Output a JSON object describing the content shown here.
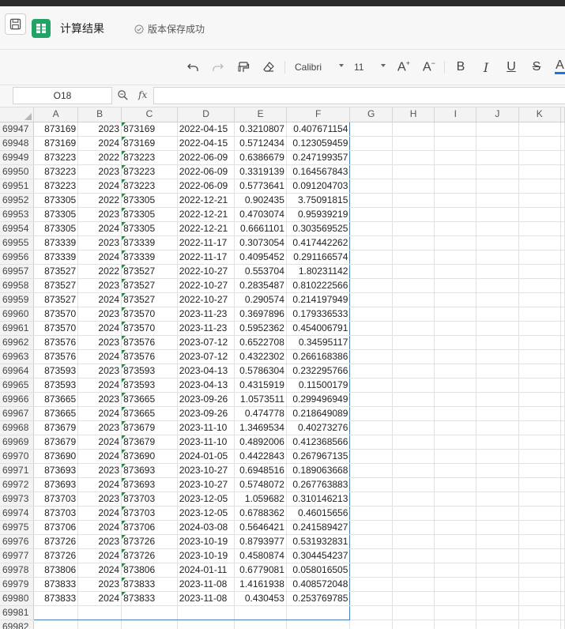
{
  "titlebar": {
    "doc_title": "计算结果",
    "save_status": "版本保存成功"
  },
  "toolbar": {
    "font_name": "Calibri",
    "font_size": "11",
    "bold": "B",
    "italic": "I",
    "underline": "U",
    "strike": "S",
    "font_color": "A"
  },
  "formula_bar": {
    "cell_ref": "O18",
    "fx": "fx",
    "value": ""
  },
  "colors": {
    "accent": "#21a366",
    "selection": "#4a7ebb",
    "text_flag": "#1e8e3e",
    "font_color_bar": "#1a73e8"
  },
  "sheet": {
    "columns": [
      "A",
      "B",
      "C",
      "D",
      "E",
      "F",
      "G",
      "H",
      "I",
      "J",
      "K"
    ],
    "rows": [
      {
        "n": "69947",
        "a": "873169",
        "b": "2023",
        "c": "873169",
        "d": "2022-04-15",
        "e": "0.3210807",
        "f": "0.407671154"
      },
      {
        "n": "69948",
        "a": "873169",
        "b": "2024",
        "c": "873169",
        "d": "2022-04-15",
        "e": "0.5712434",
        "f": "0.123059459"
      },
      {
        "n": "69949",
        "a": "873223",
        "b": "2022",
        "c": "873223",
        "d": "2022-06-09",
        "e": "0.6386679",
        "f": "0.247199357"
      },
      {
        "n": "69950",
        "a": "873223",
        "b": "2023",
        "c": "873223",
        "d": "2022-06-09",
        "e": "0.3319139",
        "f": "0.164567843"
      },
      {
        "n": "69951",
        "a": "873223",
        "b": "2024",
        "c": "873223",
        "d": "2022-06-09",
        "e": "0.5773641",
        "f": "0.091204703"
      },
      {
        "n": "69952",
        "a": "873305",
        "b": "2022",
        "c": "873305",
        "d": "2022-12-21",
        "e": "0.902435",
        "f": "3.75091815"
      },
      {
        "n": "69953",
        "a": "873305",
        "b": "2023",
        "c": "873305",
        "d": "2022-12-21",
        "e": "0.4703074",
        "f": "0.95939219"
      },
      {
        "n": "69954",
        "a": "873305",
        "b": "2024",
        "c": "873305",
        "d": "2022-12-21",
        "e": "0.6661101",
        "f": "0.303569525"
      },
      {
        "n": "69955",
        "a": "873339",
        "b": "2023",
        "c": "873339",
        "d": "2022-11-17",
        "e": "0.3073054",
        "f": "0.417442262"
      },
      {
        "n": "69956",
        "a": "873339",
        "b": "2024",
        "c": "873339",
        "d": "2022-11-17",
        "e": "0.4095452",
        "f": "0.291166574"
      },
      {
        "n": "69957",
        "a": "873527",
        "b": "2022",
        "c": "873527",
        "d": "2022-10-27",
        "e": "0.553704",
        "f": "1.80231142"
      },
      {
        "n": "69958",
        "a": "873527",
        "b": "2023",
        "c": "873527",
        "d": "2022-10-27",
        "e": "0.2835487",
        "f": "0.810222566"
      },
      {
        "n": "69959",
        "a": "873527",
        "b": "2024",
        "c": "873527",
        "d": "2022-10-27",
        "e": "0.290574",
        "f": "0.214197949"
      },
      {
        "n": "69960",
        "a": "873570",
        "b": "2023",
        "c": "873570",
        "d": "2023-11-23",
        "e": "0.3697896",
        "f": "0.179336533"
      },
      {
        "n": "69961",
        "a": "873570",
        "b": "2024",
        "c": "873570",
        "d": "2023-11-23",
        "e": "0.5952362",
        "f": "0.454006791"
      },
      {
        "n": "69962",
        "a": "873576",
        "b": "2023",
        "c": "873576",
        "d": "2023-07-12",
        "e": "0.6522708",
        "f": "0.34595117"
      },
      {
        "n": "69963",
        "a": "873576",
        "b": "2024",
        "c": "873576",
        "d": "2023-07-12",
        "e": "0.4322302",
        "f": "0.266168386"
      },
      {
        "n": "69964",
        "a": "873593",
        "b": "2023",
        "c": "873593",
        "d": "2023-04-13",
        "e": "0.5786304",
        "f": "0.232295766"
      },
      {
        "n": "69965",
        "a": "873593",
        "b": "2024",
        "c": "873593",
        "d": "2023-04-13",
        "e": "0.4315919",
        "f": "0.11500179"
      },
      {
        "n": "69966",
        "a": "873665",
        "b": "2023",
        "c": "873665",
        "d": "2023-09-26",
        "e": "1.0573511",
        "f": "0.299496949"
      },
      {
        "n": "69967",
        "a": "873665",
        "b": "2024",
        "c": "873665",
        "d": "2023-09-26",
        "e": "0.474778",
        "f": "0.218649089"
      },
      {
        "n": "69968",
        "a": "873679",
        "b": "2023",
        "c": "873679",
        "d": "2023-11-10",
        "e": "1.3469534",
        "f": "0.40273276"
      },
      {
        "n": "69969",
        "a": "873679",
        "b": "2024",
        "c": "873679",
        "d": "2023-11-10",
        "e": "0.4892006",
        "f": "0.412368566"
      },
      {
        "n": "69970",
        "a": "873690",
        "b": "2024",
        "c": "873690",
        "d": "2024-01-05",
        "e": "0.4422843",
        "f": "0.267967135"
      },
      {
        "n": "69971",
        "a": "873693",
        "b": "2023",
        "c": "873693",
        "d": "2023-10-27",
        "e": "0.6948516",
        "f": "0.189063668"
      },
      {
        "n": "69972",
        "a": "873693",
        "b": "2024",
        "c": "873693",
        "d": "2023-10-27",
        "e": "0.5748072",
        "f": "0.267763883"
      },
      {
        "n": "69973",
        "a": "873703",
        "b": "2023",
        "c": "873703",
        "d": "2023-12-05",
        "e": "1.059682",
        "f": "0.310146213"
      },
      {
        "n": "69974",
        "a": "873703",
        "b": "2024",
        "c": "873703",
        "d": "2023-12-05",
        "e": "0.6788362",
        "f": "0.46015656"
      },
      {
        "n": "69975",
        "a": "873706",
        "b": "2024",
        "c": "873706",
        "d": "2024-03-08",
        "e": "0.5646421",
        "f": "0.241589427"
      },
      {
        "n": "69976",
        "a": "873726",
        "b": "2023",
        "c": "873726",
        "d": "2023-10-19",
        "e": "0.8793977",
        "f": "0.531932831"
      },
      {
        "n": "69977",
        "a": "873726",
        "b": "2024",
        "c": "873726",
        "d": "2023-10-19",
        "e": "0.4580874",
        "f": "0.304454237"
      },
      {
        "n": "69978",
        "a": "873806",
        "b": "2024",
        "c": "873806",
        "d": "2024-01-11",
        "e": "0.6779081",
        "f": "0.058016505"
      },
      {
        "n": "69979",
        "a": "873833",
        "b": "2023",
        "c": "873833",
        "d": "2023-11-08",
        "e": "1.4161938",
        "f": "0.408572048"
      },
      {
        "n": "69980",
        "a": "873833",
        "b": "2024",
        "c": "873833",
        "d": "2023-11-08",
        "e": "0.430453",
        "f": "0.253769785"
      },
      {
        "n": "69981",
        "a": "",
        "b": "",
        "c": "",
        "d": "",
        "e": "",
        "f": ""
      },
      {
        "n": "69982",
        "a": "",
        "b": "",
        "c": "",
        "d": "",
        "e": "",
        "f": ""
      }
    ]
  }
}
